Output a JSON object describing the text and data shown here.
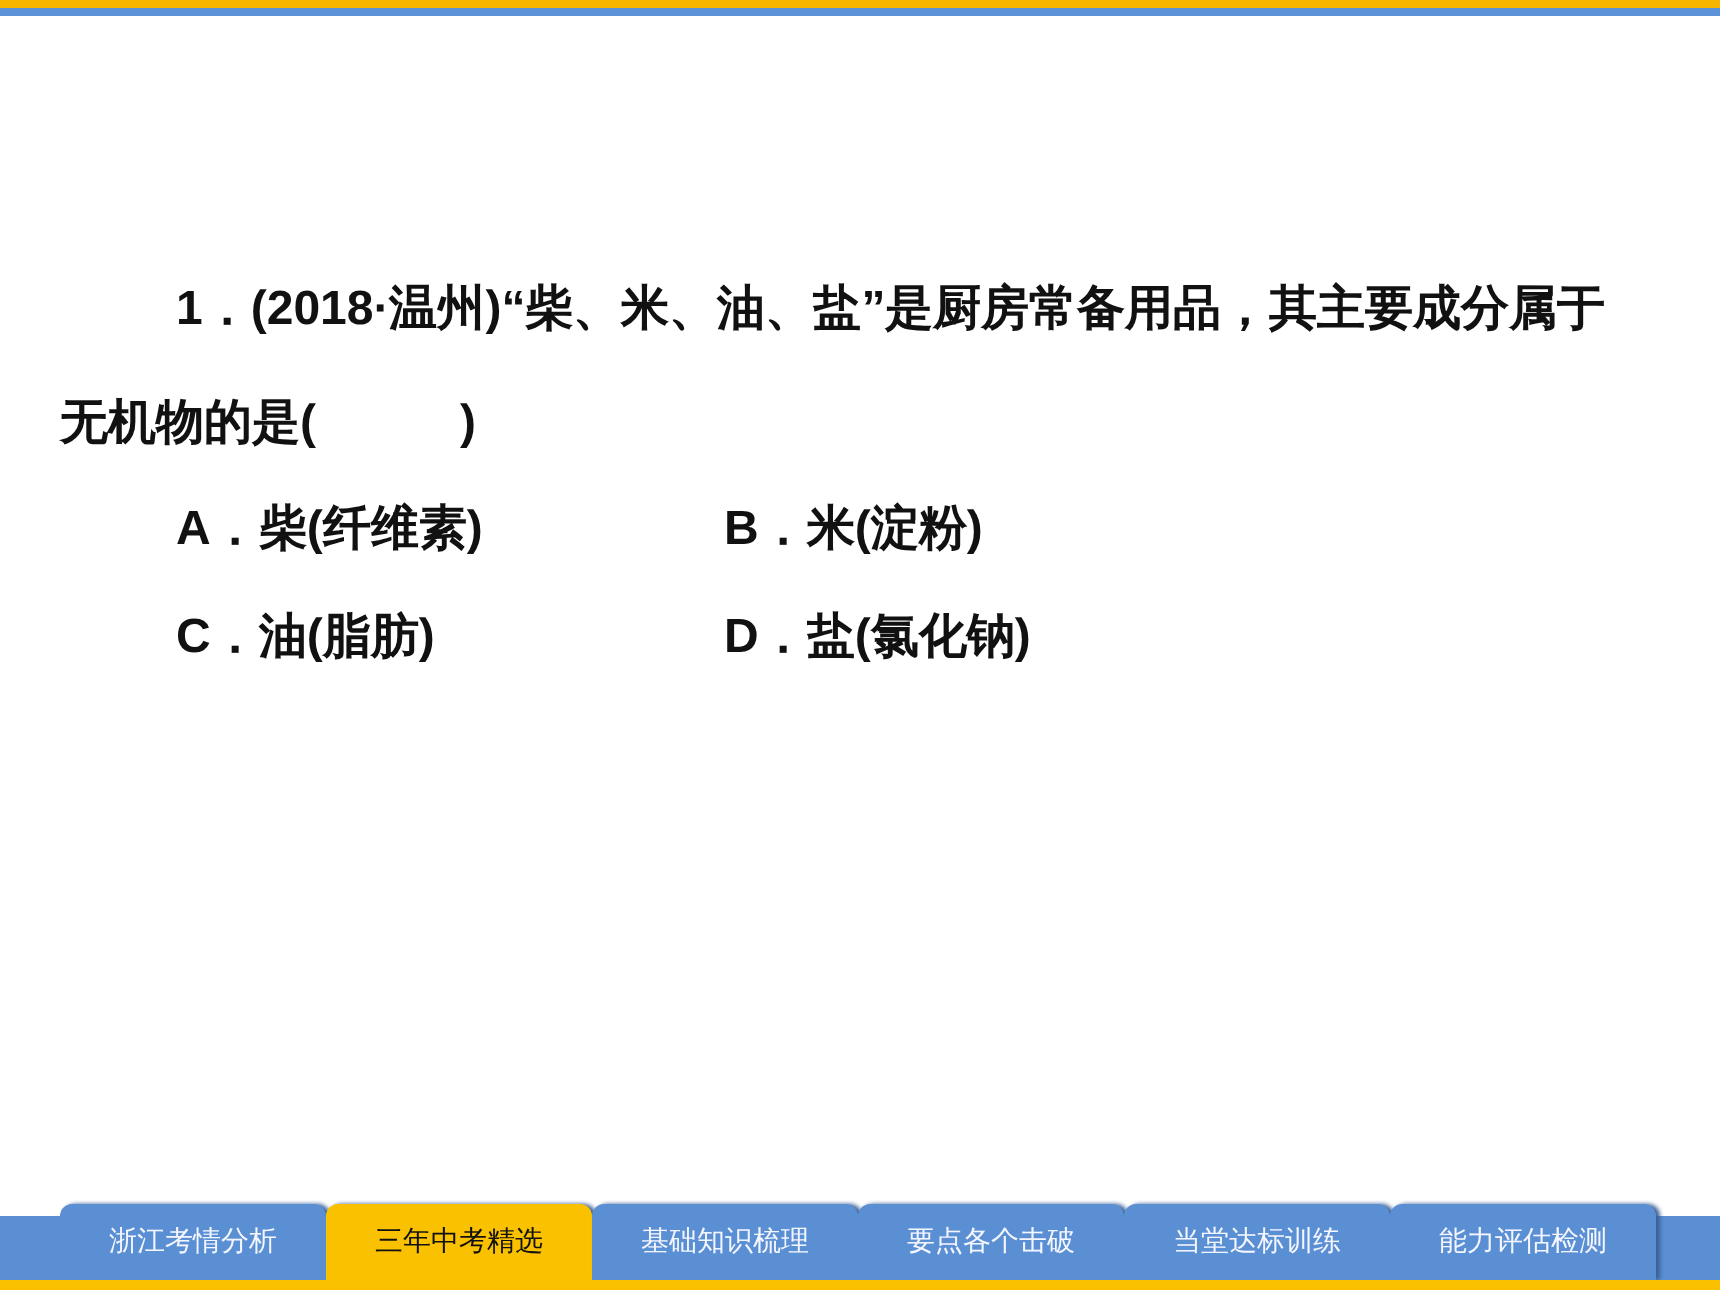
{
  "question": {
    "stem": "1．(2018·温州)“柴、米、油、盐”是厨房常备用品，其主要成分属于无机物的是(　　　)",
    "options": [
      {
        "label": "A．柴(纤维素)"
      },
      {
        "label": "B．米(淀粉)"
      },
      {
        "label": "C．油(脂肪)"
      },
      {
        "label": "D．盐(氯化钠)"
      }
    ]
  },
  "nav_tabs": [
    {
      "label": "浙江考情分析",
      "selected": false
    },
    {
      "label": "三年中考精选",
      "selected": true
    },
    {
      "label": "基础知识梳理",
      "selected": false
    },
    {
      "label": "要点各个击破",
      "selected": false
    },
    {
      "label": "当堂达标训练",
      "selected": false
    },
    {
      "label": "能力评估检测",
      "selected": false
    }
  ]
}
